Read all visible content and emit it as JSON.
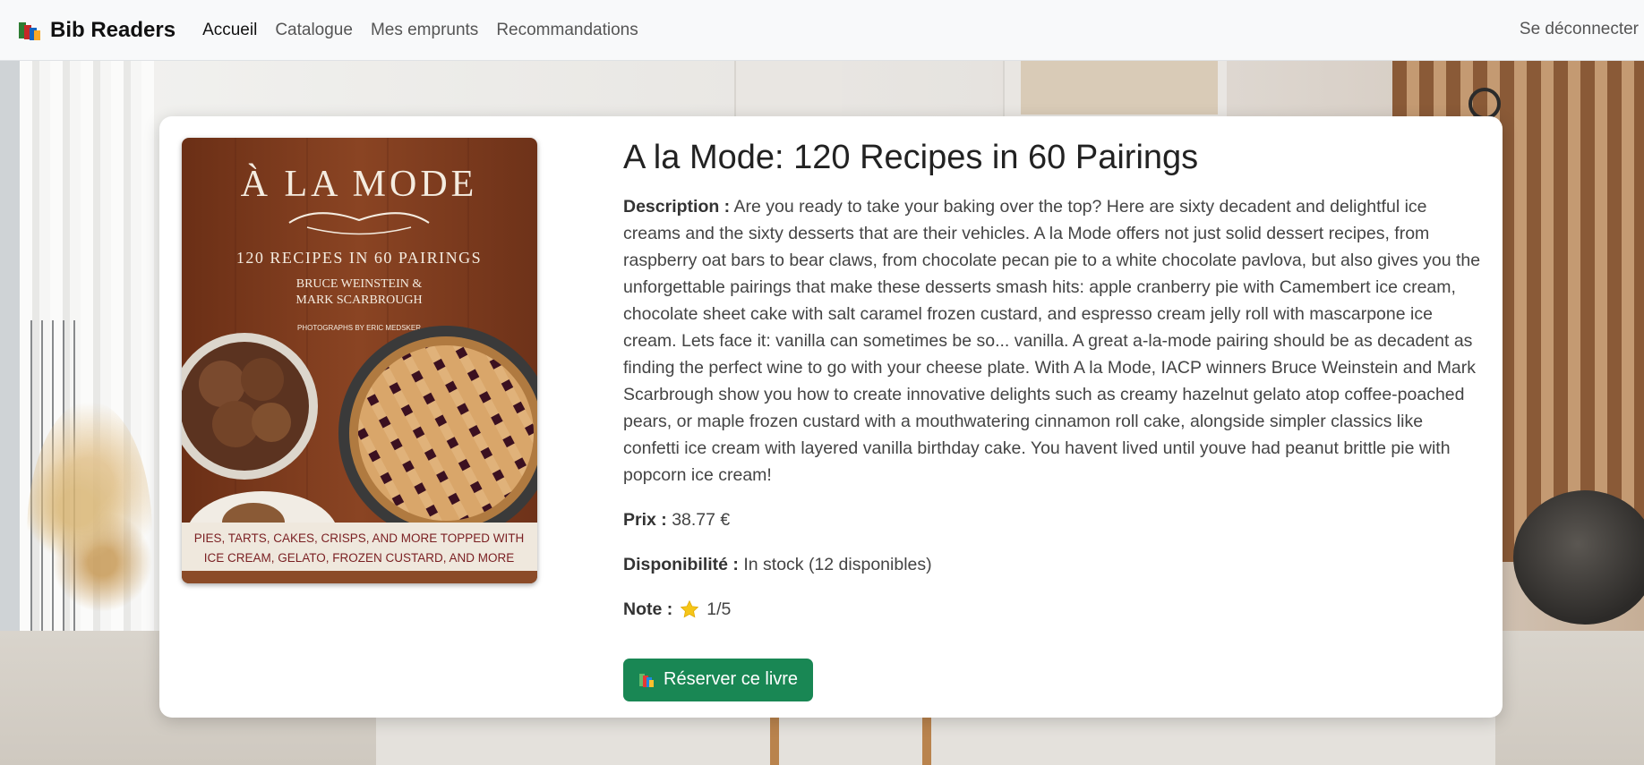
{
  "navbar": {
    "brand": "Bib Readers",
    "links": [
      {
        "label": "Accueil",
        "active": true
      },
      {
        "label": "Catalogue",
        "active": false
      },
      {
        "label": "Mes emprunts",
        "active": false
      },
      {
        "label": "Recommandations",
        "active": false
      }
    ],
    "logout": "Se déconnecter"
  },
  "book": {
    "title": "A la Mode: 120 Recipes in 60 Pairings",
    "description_label": "Description :",
    "description": "Are you ready to take your baking over the top? Here are sixty decadent and delightful ice creams and the sixty desserts that are their vehicles. A la Mode offers not just solid dessert recipes, from raspberry oat bars to bear claws, from chocolate pecan pie to a white chocolate pavlova, but also gives you the unforgettable pairings that make these desserts smash hits: apple cranberry pie with Camembert ice cream, chocolate sheet cake with salt caramel frozen custard, and espresso cream jelly roll with mascarpone ice cream. Lets face it: vanilla can sometimes be so... vanilla. A great a-la-mode pairing should be as decadent as finding the perfect wine to go with your cheese plate. With A la Mode, IACP winners Bruce Weinstein and Mark Scarbrough show you how to create innovative delights such as creamy hazelnut gelato atop coffee-poached pears, or maple frozen custard with a mouthwatering cinnamon roll cake, alongside simpler classics like confetti ice cream with layered vanilla birthday cake. You havent lived until youve had peanut brittle pie with popcorn ice cream!",
    "price_label": "Prix :",
    "price": "38.77 €",
    "availability_label": "Disponibilité :",
    "availability": "In stock (12 disponibles)",
    "rating_label": "Note :",
    "rating": "1/5",
    "reserve_button": "Réserver ce livre"
  },
  "cover": {
    "title": "À LA MODE",
    "subtitle": "120 RECIPES IN 60 PAIRINGS",
    "authors_line1": "BRUCE WEINSTEIN &",
    "authors_line2": "MARK SCARBROUGH",
    "photographer": "PHOTOGRAPHS BY ERIC MEDSKER",
    "tagline_line1": "PIES, TARTS, CAKES, CRISPS, AND MORE TOPPED WITH",
    "tagline_line2": "ICE CREAM, GELATO, FROZEN CUSTARD, AND MORE"
  },
  "colors": {
    "accent_button": "#198754",
    "star": "#f5c518",
    "cover_wood": "#7a3a1e"
  },
  "icons": {
    "brand": "books-icon",
    "rating": "star-icon",
    "button": "books-icon"
  }
}
